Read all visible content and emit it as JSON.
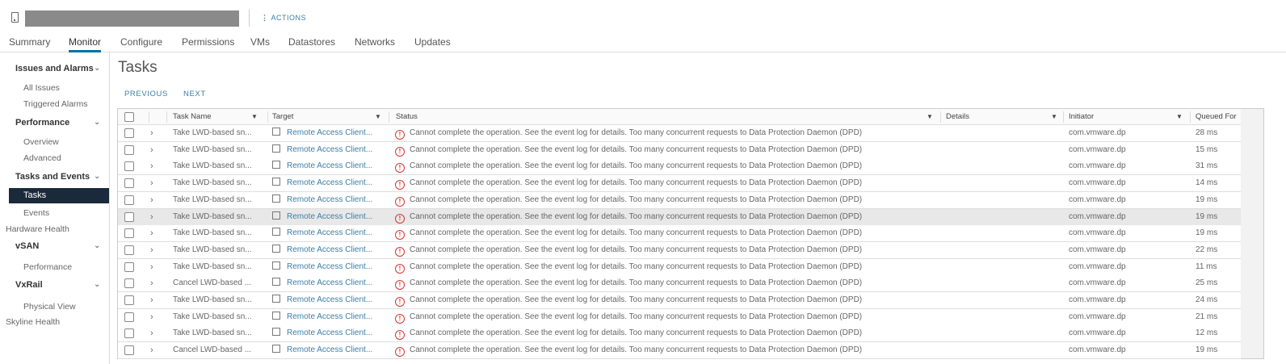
{
  "header": {
    "actions_label": "ACTIONS"
  },
  "tabs": [
    "Summary",
    "Monitor",
    "Configure",
    "Permissions",
    "VMs",
    "Datastores",
    "Networks",
    "Updates"
  ],
  "sidebar": {
    "groups": [
      {
        "label": "Issues and Alarms",
        "items": [
          "All Issues",
          "Triggered Alarms"
        ]
      },
      {
        "label": "Performance",
        "items": [
          "Overview",
          "Advanced"
        ]
      },
      {
        "label": "Tasks and Events",
        "items": [
          "Tasks",
          "Events"
        ]
      },
      {
        "label": "Hardware Health"
      },
      {
        "label": "vSAN",
        "items": [
          "Performance"
        ]
      },
      {
        "label": "VxRail",
        "items": [
          "Physical View"
        ]
      },
      {
        "label": "Skyline Health"
      }
    ]
  },
  "page": {
    "title": "Tasks",
    "previous": "PREVIOUS",
    "next": "NEXT"
  },
  "table": {
    "columns": [
      "Task Name",
      "Target",
      "Status",
      "Details",
      "Initiator",
      "Queued For"
    ],
    "rows": [
      {
        "task": "Take LWD-based sn...",
        "target": "Remote Access Client...",
        "status": "Cannot complete the operation. See the event log for details. Too many concurrent requests to Data Protection Daemon (DPD)",
        "details": "",
        "initiator": "com.vmware.dp",
        "queued": "28 ms"
      },
      {
        "task": "Take LWD-based sn...",
        "target": "Remote Access Client...",
        "status": "Cannot complete the operation. See the event log for details. Too many concurrent requests to Data Protection Daemon (DPD)",
        "details": "",
        "initiator": "com.vmware.dp",
        "queued": "15 ms"
      },
      {
        "task": "Take LWD-based sn...",
        "target": "Remote Access Client...",
        "status": "Cannot complete the operation. See the event log for details. Too many concurrent requests to Data Protection Daemon (DPD)",
        "details": "",
        "initiator": "com.vmware.dp",
        "queued": "31 ms"
      },
      {
        "task": "Take LWD-based sn...",
        "target": "Remote Access Client...",
        "status": "Cannot complete the operation. See the event log for details. Too many concurrent requests to Data Protection Daemon (DPD)",
        "details": "",
        "initiator": "com.vmware.dp",
        "queued": "14 ms"
      },
      {
        "task": "Take LWD-based sn...",
        "target": "Remote Access Client...",
        "status": "Cannot complete the operation. See the event log for details. Too many concurrent requests to Data Protection Daemon (DPD)",
        "details": "",
        "initiator": "com.vmware.dp",
        "queued": "19 ms"
      },
      {
        "task": "Take LWD-based sn...",
        "target": "Remote Access Client...",
        "status": "Cannot complete the operation. See the event log for details. Too many concurrent requests to Data Protection Daemon (DPD)",
        "details": "",
        "initiator": "com.vmware.dp",
        "queued": "19 ms"
      },
      {
        "task": "Take LWD-based sn...",
        "target": "Remote Access Client...",
        "status": "Cannot complete the operation. See the event log for details. Too many concurrent requests to Data Protection Daemon (DPD)",
        "details": "",
        "initiator": "com.vmware.dp",
        "queued": "19 ms"
      },
      {
        "task": "Take LWD-based sn...",
        "target": "Remote Access Client...",
        "status": "Cannot complete the operation. See the event log for details. Too many concurrent requests to Data Protection Daemon (DPD)",
        "details": "",
        "initiator": "com.vmware.dp",
        "queued": "22 ms"
      },
      {
        "task": "Take LWD-based sn...",
        "target": "Remote Access Client...",
        "status": "Cannot complete the operation. See the event log for details. Too many concurrent requests to Data Protection Daemon (DPD)",
        "details": "",
        "initiator": "com.vmware.dp",
        "queued": "11 ms"
      },
      {
        "task": "Cancel LWD-based ...",
        "target": "Remote Access Client...",
        "status": "Cannot complete the operation. See the event log for details. Too many concurrent requests to Data Protection Daemon (DPD)",
        "details": "",
        "initiator": "com.vmware.dp",
        "queued": "25 ms"
      },
      {
        "task": "Take LWD-based sn...",
        "target": "Remote Access Client...",
        "status": "Cannot complete the operation. See the event log for details. Too many concurrent requests to Data Protection Daemon (DPD)",
        "details": "",
        "initiator": "com.vmware.dp",
        "queued": "24 ms"
      },
      {
        "task": "Take LWD-based sn...",
        "target": "Remote Access Client...",
        "status": "Cannot complete the operation. See the event log for details. Too many concurrent requests to Data Protection Daemon (DPD)",
        "details": "",
        "initiator": "com.vmware.dp",
        "queued": "21 ms"
      },
      {
        "task": "Take LWD-based sn...",
        "target": "Remote Access Client...",
        "status": "Cannot complete the operation. See the event log for details. Too many concurrent requests to Data Protection Daemon (DPD)",
        "details": "",
        "initiator": "com.vmware.dp",
        "queued": "12 ms"
      },
      {
        "task": "Cancel LWD-based ...",
        "target": "Remote Access Client...",
        "status": "Cannot complete the operation. See the event log for details. Too many concurrent requests to Data Protection Daemon (DPD)",
        "details": "",
        "initiator": "com.vmware.dp",
        "queued": "19 ms"
      }
    ]
  }
}
